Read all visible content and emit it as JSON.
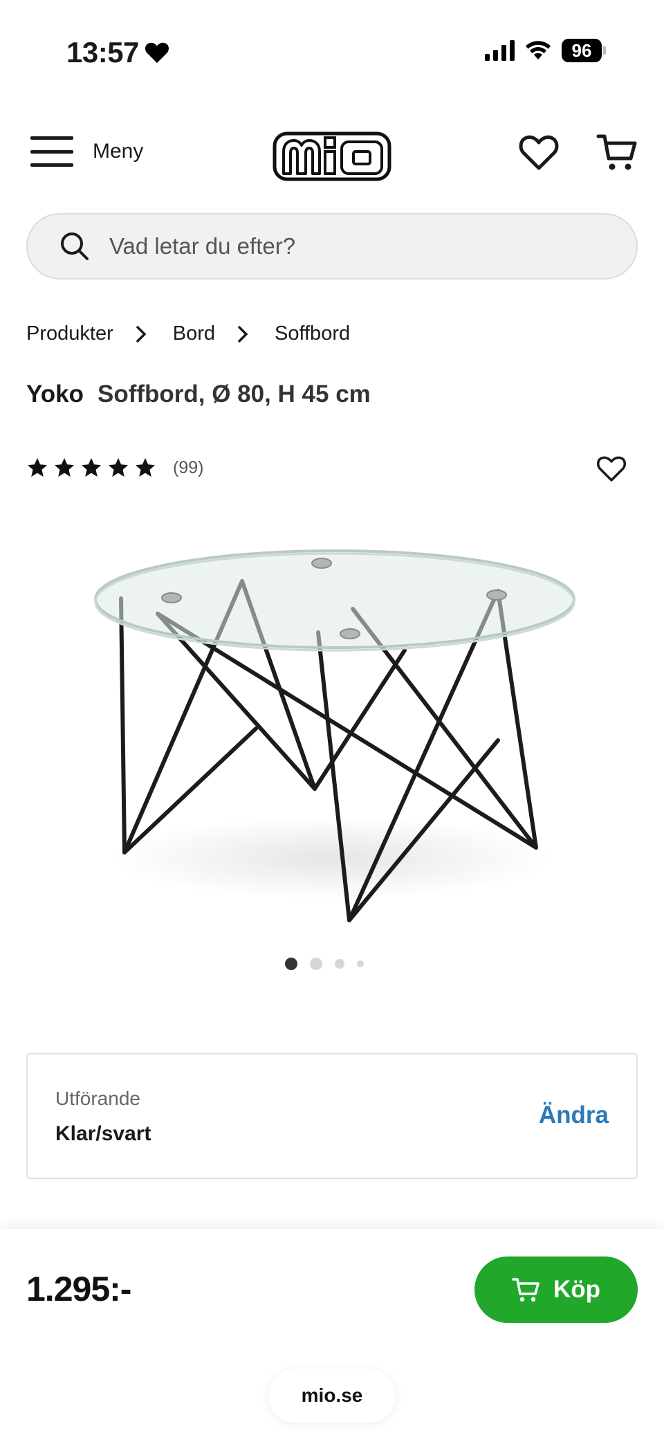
{
  "status_bar": {
    "time": "13:57",
    "battery": "96"
  },
  "header": {
    "menu_label": "Meny",
    "logo_text": "mio"
  },
  "search": {
    "placeholder": "Vad letar du efter?"
  },
  "breadcrumb": [
    "Produkter",
    "Bord",
    "Soffbord"
  ],
  "product": {
    "brand": "Yoko",
    "description": "Soffbord, Ø 80, H 45 cm",
    "rating_count": "(99)",
    "rating": 5,
    "image_count": 4,
    "active_image": 1
  },
  "variant": {
    "label": "Utförande",
    "value": "Klar/svart",
    "change_label": "Ändra"
  },
  "footer": {
    "price": "1.295:-",
    "buy_label": "Köp",
    "url": "mio.se"
  },
  "colors": {
    "buy_button": "#21a82b",
    "link": "#2b79b8"
  }
}
